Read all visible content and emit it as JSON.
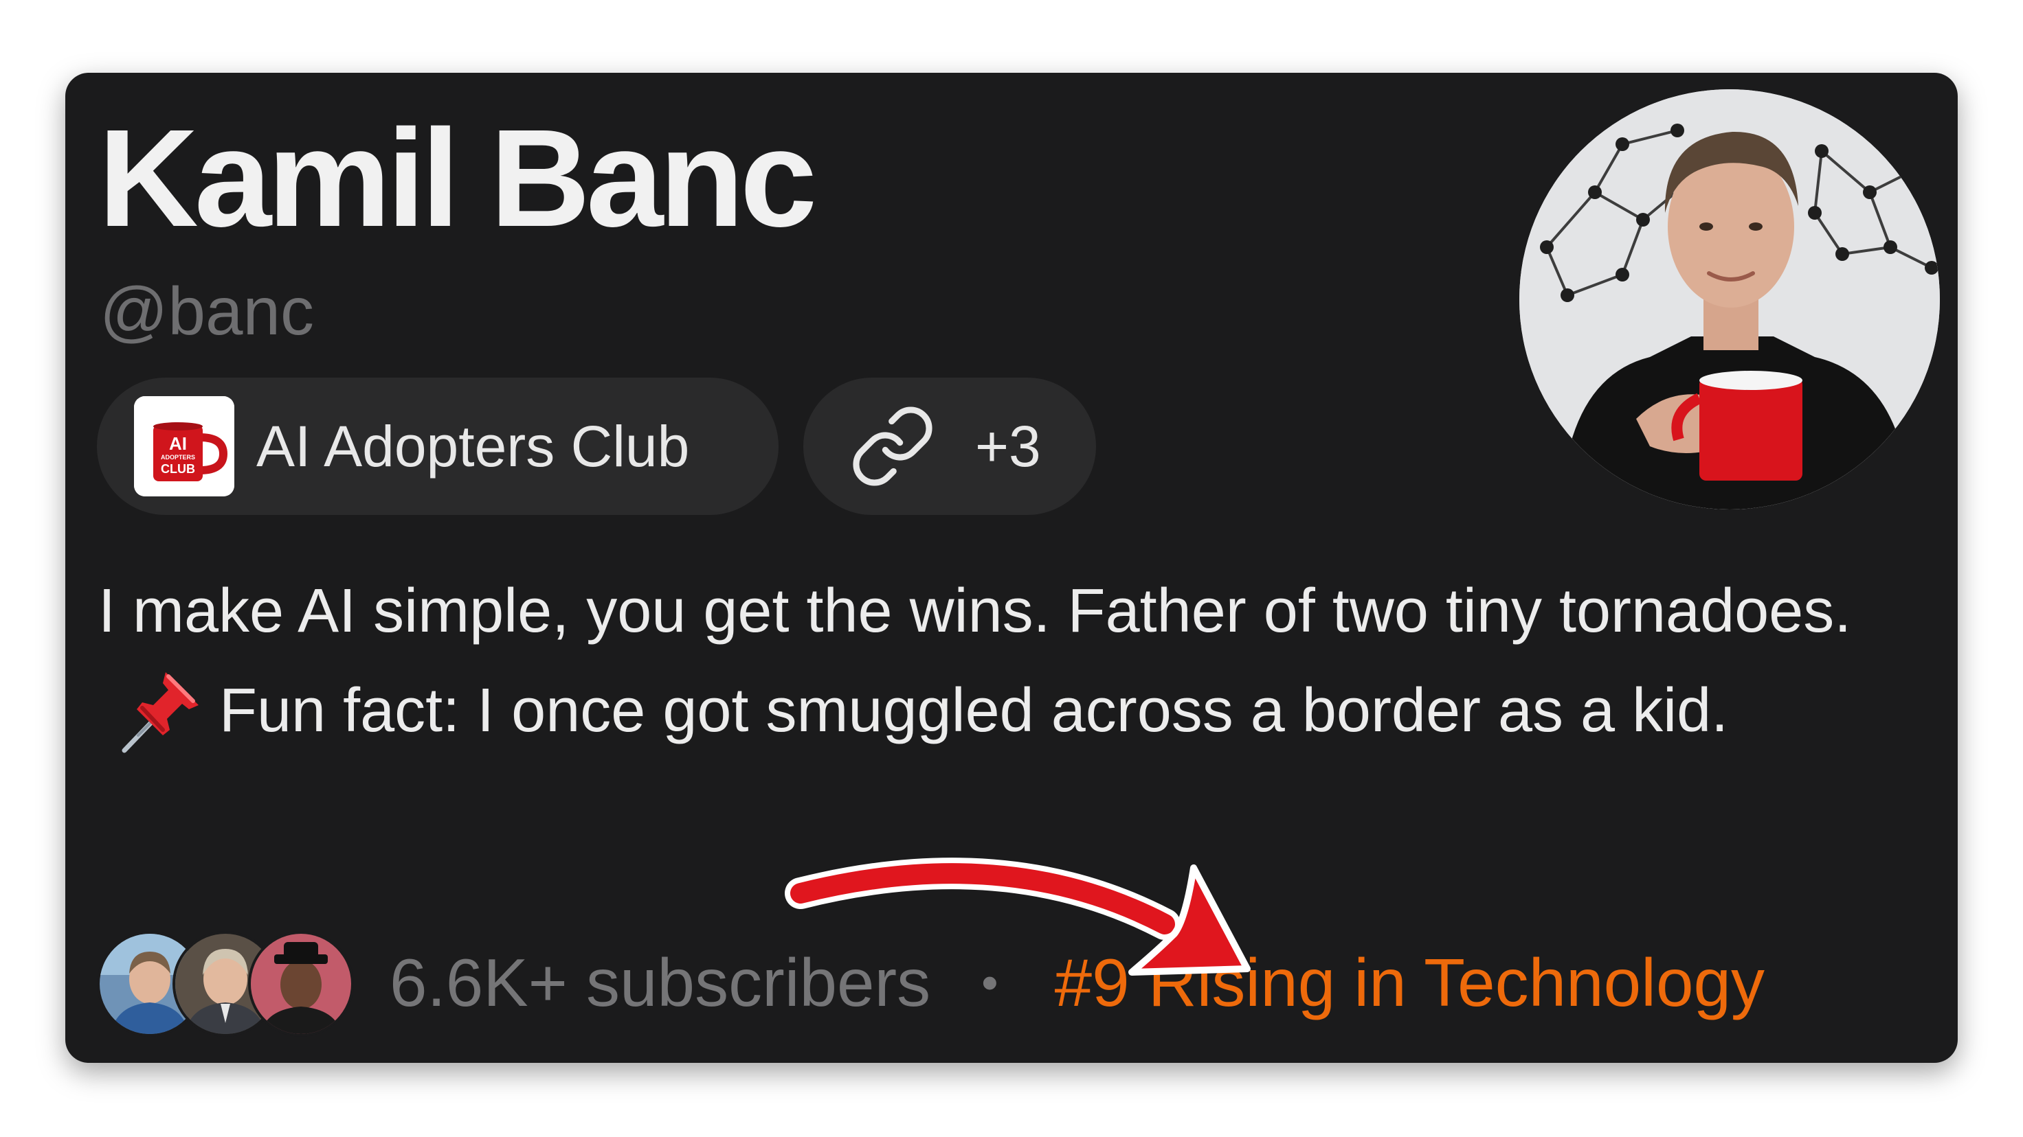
{
  "profile": {
    "name": "Kamil Banc",
    "handle": "@banc",
    "publication": {
      "name": "AI Adopters Club",
      "logo_text": "AI ADOPTERS CLUB",
      "logo_icon": "red-mug-logo"
    },
    "links": {
      "icon": "link-icon",
      "count_label": "+3"
    },
    "bio": {
      "line1": "I make AI simple, you get the wins. Father of two tiny tornadoes.",
      "emoji": "pushpin-emoji",
      "line2": "Fun fact: I once got smuggled across a border as a kid."
    },
    "avatar": "profile-photo"
  },
  "footer": {
    "subscribers_label": "6.6K+ subscribers",
    "separator": "•",
    "ranking_label": "#9 Rising in Technology"
  },
  "colors": {
    "card_background": "#1b1b1c",
    "pill_background": "#2a2a2b",
    "accent_orange": "#ee6a0b",
    "arrow_red": "#e0161e",
    "muted_text": "#757577"
  },
  "annotation": {
    "arrow_icon": "red-curved-arrow"
  }
}
